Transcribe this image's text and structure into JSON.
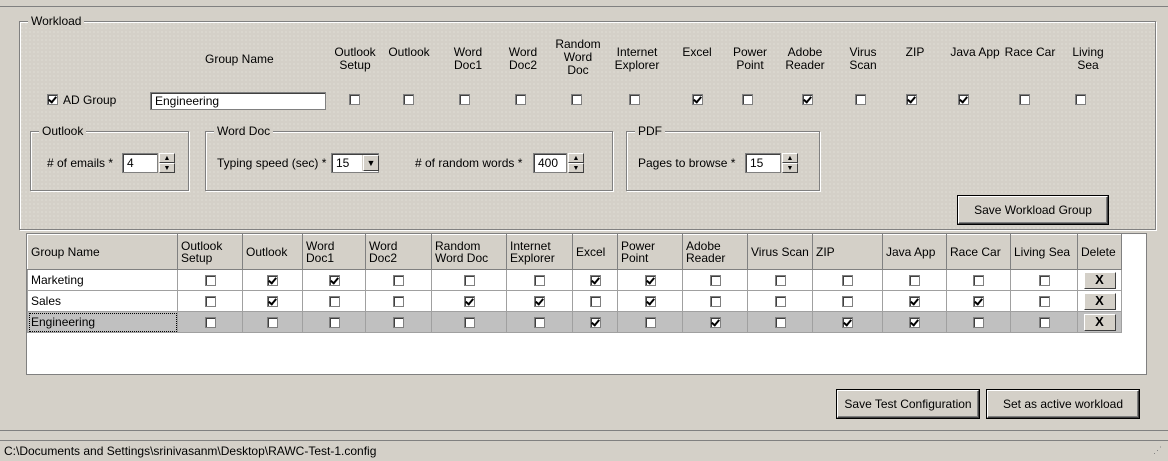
{
  "workload": {
    "title": "Workload",
    "group_name_header": "Group Name",
    "app_headers": [
      "Outlook Setup",
      "Outlook",
      "Word Doc1",
      "Word Doc2",
      "Random Word Doc",
      "Internet Explorer",
      "Excel",
      "Power Point",
      "Adobe Reader",
      "Virus Scan",
      "ZIP",
      "Java App",
      "Race Car",
      "Living Sea"
    ],
    "ad_group_label": "AD Group",
    "ad_group_checked": true,
    "group_name_value": "Engineering",
    "app_checks": [
      false,
      false,
      false,
      false,
      false,
      false,
      true,
      false,
      true,
      false,
      true,
      true,
      false,
      false
    ],
    "outlook": {
      "title": "Outlook",
      "emails_label": "# of emails *",
      "emails_value": "4"
    },
    "word_doc": {
      "title": "Word Doc",
      "typing_label": "Typing speed (sec) *",
      "typing_value": "15",
      "random_words_label": "# of random words *",
      "random_words_value": "400"
    },
    "pdf": {
      "title": "PDF",
      "pages_label": "Pages to browse *",
      "pages_value": "15"
    },
    "save_group_button": "Save Workload Group"
  },
  "table": {
    "headers": [
      "Group Name",
      "Outlook Setup",
      "Outlook",
      "Word Doc1",
      "Word Doc2",
      "Random Word Doc",
      "Internet Explorer",
      "Excel",
      "Power Point",
      "Adobe Reader",
      "Virus Scan",
      "ZIP",
      "Java App",
      "Race Car",
      "Living Sea",
      "Delete"
    ],
    "rows": [
      {
        "name": "Marketing",
        "checks": [
          false,
          true,
          true,
          false,
          false,
          false,
          true,
          true,
          false,
          false,
          false,
          false,
          false,
          false
        ],
        "selected": false
      },
      {
        "name": "Sales",
        "checks": [
          false,
          true,
          false,
          false,
          true,
          true,
          false,
          true,
          false,
          false,
          false,
          true,
          true,
          false
        ],
        "selected": false
      },
      {
        "name": "Engineering",
        "checks": [
          false,
          false,
          false,
          false,
          false,
          false,
          true,
          false,
          true,
          false,
          true,
          true,
          false,
          false
        ],
        "selected": true
      }
    ],
    "delete_glyph": "X"
  },
  "buttons": {
    "save_test": "Save Test Configuration",
    "set_active": "Set as active workload"
  },
  "status_bar": {
    "path": "C:\\Documents and Settings\\srinivasanm\\Desktop\\RAWC-Test-1.config"
  }
}
